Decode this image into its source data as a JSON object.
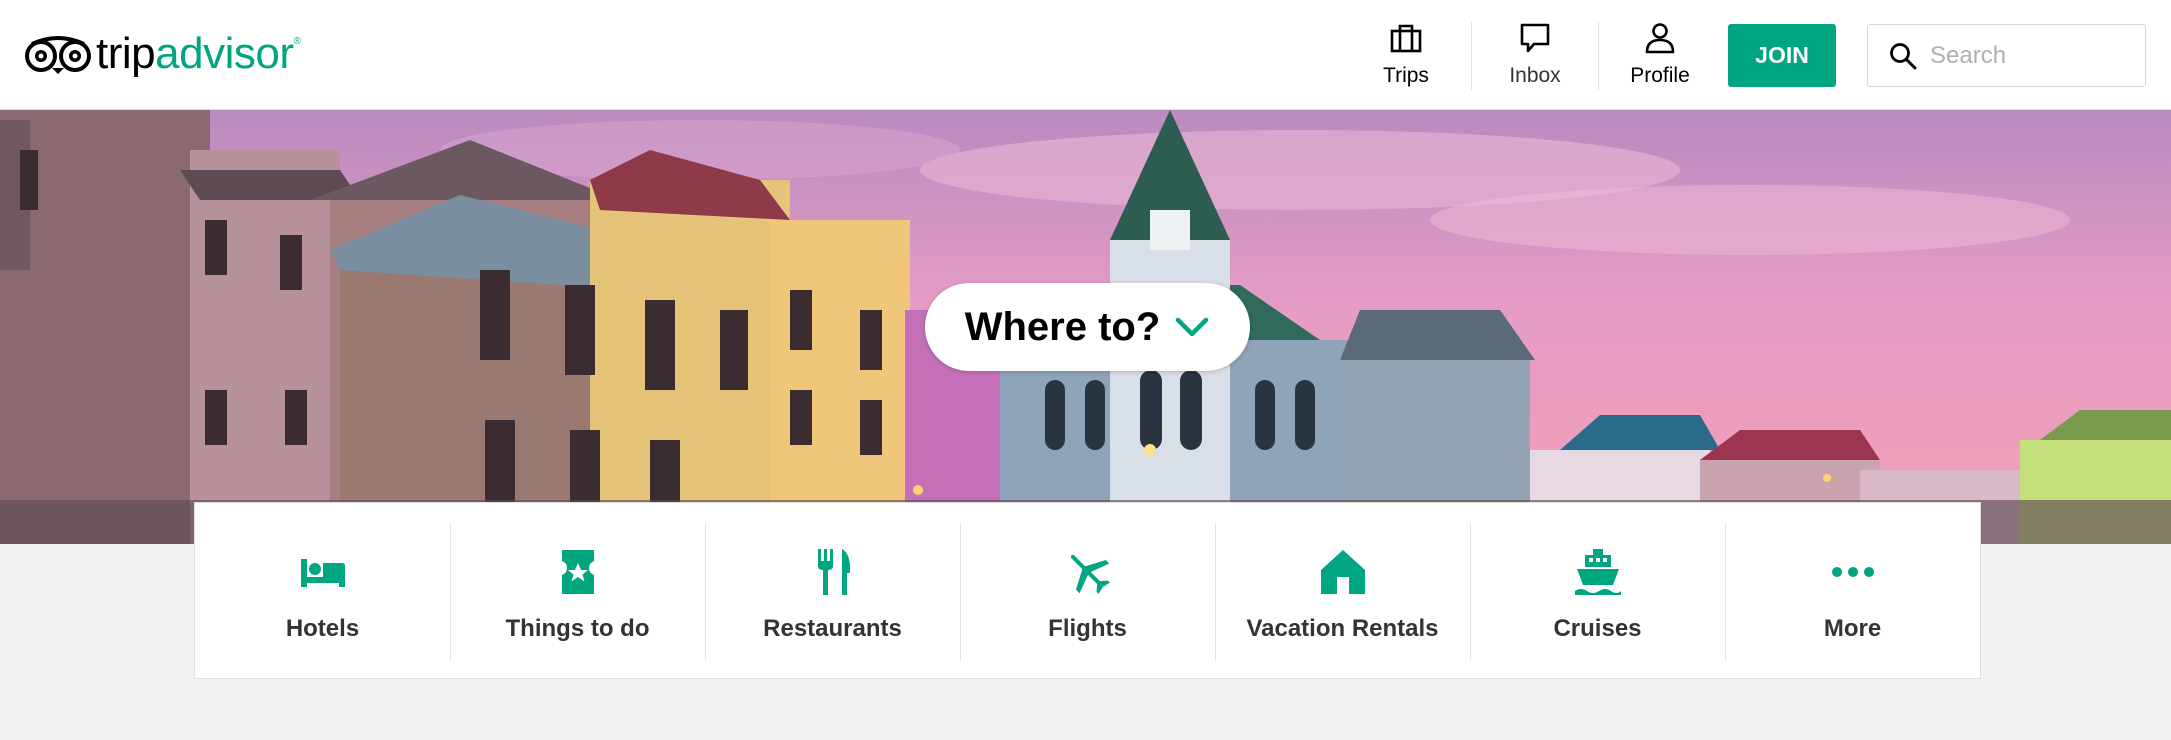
{
  "header": {
    "logo": {
      "prefix": "trip",
      "suffix": "advisor",
      "mark": "®"
    },
    "nav": [
      {
        "label": "Trips",
        "icon": "briefcase-icon"
      },
      {
        "label": "Inbox",
        "icon": "speech-bubble-icon"
      },
      {
        "label": "Profile",
        "icon": "person-icon"
      }
    ],
    "join_label": "JOIN",
    "search": {
      "placeholder": "Search",
      "value": ""
    }
  },
  "hero": {
    "where_to_label": "Where to?"
  },
  "categories": [
    {
      "label": "Hotels",
      "icon": "bed-icon"
    },
    {
      "label": "Things to do",
      "icon": "ticket-icon"
    },
    {
      "label": "Restaurants",
      "icon": "fork-knife-icon"
    },
    {
      "label": "Flights",
      "icon": "plane-icon"
    },
    {
      "label": "Vacation Rentals",
      "icon": "house-icon"
    },
    {
      "label": "Cruises",
      "icon": "ship-icon"
    },
    {
      "label": "More",
      "icon": "more-dots-icon"
    }
  ],
  "colors": {
    "brand": "#00a680",
    "text": "#000000",
    "page_bg": "#f2f2f2"
  }
}
